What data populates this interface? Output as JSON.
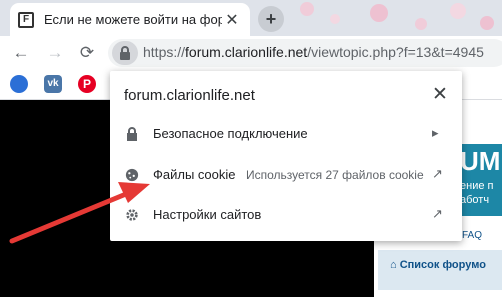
{
  "tab": {
    "title": "Если не можете войти на форум",
    "favicon_letter": "F",
    "close": "✕"
  },
  "toolbar": {
    "back": "←",
    "forward": "→",
    "reload": "⟳",
    "url_scheme": "https://",
    "url_host": "forum.clarionlife.net",
    "url_path": "/viewtopic.php?f=13&t=4945"
  },
  "bookmarks": [
    {
      "icon": "firefox-icon",
      "color": "#2b6fd6"
    },
    {
      "icon": "vk-icon",
      "color": "#4a76a8"
    },
    {
      "icon": "pinterest-icon",
      "color": "#e60023"
    }
  ],
  "popup": {
    "host": "forum.clarionlife.net",
    "close": "✕",
    "rows": [
      {
        "label": "Безопасное подключение",
        "end": "▸"
      },
      {
        "label": "Файлы cookie",
        "desc": "Используется 27 файлов cookie",
        "end": "↗"
      },
      {
        "label": "Настройки сайтов",
        "end": "↗"
      }
    ]
  },
  "page": {
    "banner_big": "UM",
    "banner_line1": "ение п",
    "banner_line2": "аботч",
    "faq": "FAQ",
    "forum_list": "Список форумо"
  },
  "colors": {
    "arrow": "#e53935",
    "banner": "#1d87a6"
  }
}
